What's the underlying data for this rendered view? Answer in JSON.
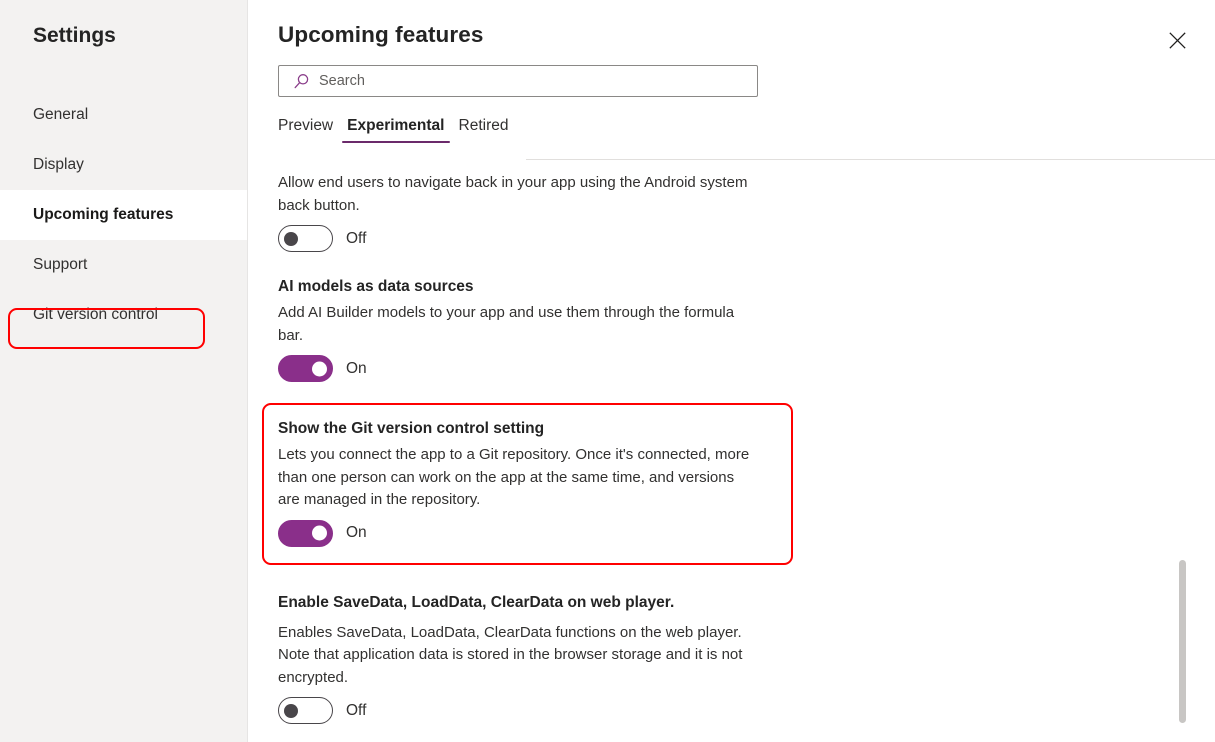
{
  "sidebar": {
    "title": "Settings",
    "items": [
      {
        "label": "General",
        "selected": false
      },
      {
        "label": "Display",
        "selected": false
      },
      {
        "label": "Upcoming features",
        "selected": true
      },
      {
        "label": "Support",
        "selected": false
      },
      {
        "label": "Git version control",
        "selected": false,
        "annotated": true
      }
    ]
  },
  "panel": {
    "title": "Upcoming features",
    "close_icon": "close-icon",
    "search": {
      "icon": "search-icon",
      "value": "",
      "placeholder": "Search"
    },
    "tabs": [
      {
        "label": "Preview",
        "active": false
      },
      {
        "label": "Experimental",
        "active": true
      },
      {
        "label": "Retired",
        "active": false
      }
    ],
    "features": [
      {
        "title": "",
        "description": "Allow end users to navigate back in your app using the Android system back button.",
        "toggle_state": "off",
        "toggle_label": "Off",
        "annotated": false
      },
      {
        "title": "AI models as data sources",
        "description": "Add AI Builder models to your app and use them through the formula bar.",
        "toggle_state": "on",
        "toggle_label": "On",
        "annotated": false
      },
      {
        "title": "Show the Git version control setting",
        "description": "Lets you connect the app to a Git repository. Once it's connected, more than one person can work on the app at the same time, and versions are managed in the repository.",
        "toggle_state": "on",
        "toggle_label": "On",
        "annotated": true
      },
      {
        "title": "Enable SaveData, LoadData, ClearData on web player.",
        "description": "Enables SaveData, LoadData, ClearData functions on the web player. Note that application data is stored in the browser storage and it is not encrypted.",
        "toggle_state": "off",
        "toggle_label": "Off",
        "annotated": false
      }
    ]
  },
  "colors": {
    "accent_purple": "#8a2f8a",
    "tab_underline": "#6b2a6b",
    "annotation_red": "#ff0000",
    "sidebar_bg": "#f3f2f1",
    "scrollbar_thumb": "#c8c6c4"
  }
}
